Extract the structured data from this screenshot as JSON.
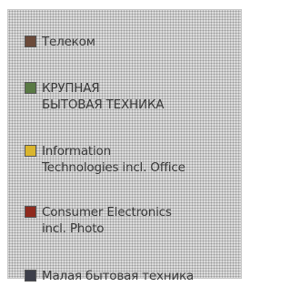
{
  "chart_data": {
    "type": "pie",
    "legend": [
      {
        "label": "Телеком",
        "color": "#6b4a3a"
      },
      {
        "label": "КРУПНАЯ\nБЫТОВАЯ ТЕХНИКА",
        "color": "#5a7a45"
      },
      {
        "label": "Information\nTechnologies incl. Office",
        "color": "#d9b52e"
      },
      {
        "label": "Consumer Electronics\nincl. Photo",
        "color": "#8f2a1e"
      },
      {
        "label": "Малая бытовая техника",
        "color": "#3d3f4a"
      }
    ]
  }
}
